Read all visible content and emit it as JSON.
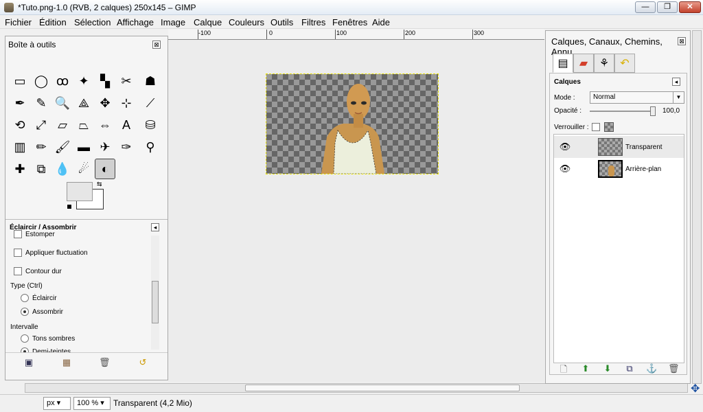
{
  "window": {
    "title": "*Tuto.png-1.0 (RVB, 2 calques) 250x145 – GIMP",
    "minimize": "—",
    "maximize": "❐",
    "close": "✕"
  },
  "menu": [
    "Fichier",
    "Édition",
    "Sélection",
    "Affichage",
    "Image",
    "Calque",
    "Couleurs",
    "Outils",
    "Filtres",
    "Fenêtres",
    "Aide"
  ],
  "ruler": {
    "labels": [
      "-100",
      "0",
      "100",
      "200",
      "300"
    ]
  },
  "toolbox": {
    "title": "Boîte à outils",
    "close": "⊠",
    "tools": [
      [
        "rect-select-icon",
        "▭"
      ],
      [
        "ellipse-select-icon",
        "◯"
      ],
      [
        "free-select-icon",
        "ꝏ"
      ],
      [
        "fuzzy-select-icon",
        "✦"
      ],
      [
        "color-select-icon",
        "▚"
      ],
      [
        "scissors-icon",
        "✂"
      ],
      [
        "foreground-select-icon",
        "☗"
      ],
      [
        "paths-icon",
        "✒"
      ],
      [
        "color-picker-icon",
        "✎"
      ],
      [
        "zoom-icon",
        "🔍"
      ],
      [
        "measure-icon",
        "⟁"
      ],
      [
        "move-icon",
        "✥"
      ],
      [
        "align-icon",
        "⊹"
      ],
      [
        "crop-icon",
        "⟋"
      ],
      [
        "rotate-icon",
        "⟲"
      ],
      [
        "scale-icon",
        "⤢"
      ],
      [
        "shear-icon",
        "▱"
      ],
      [
        "perspective-icon",
        "⏢"
      ],
      [
        "flip-icon",
        "⇔"
      ],
      [
        "text-icon",
        "A"
      ],
      [
        "bucket-fill-icon",
        "⛁"
      ],
      [
        "blend-icon",
        "▥"
      ],
      [
        "pencil-icon",
        "✏"
      ],
      [
        "paintbrush-icon",
        "🖌"
      ],
      [
        "eraser-icon",
        "▬"
      ],
      [
        "airbrush-icon",
        "✈"
      ],
      [
        "ink-icon",
        "✑"
      ],
      [
        "clone-icon",
        "⚲"
      ],
      [
        "heal-icon",
        "✚"
      ],
      [
        "perspective-clone-icon",
        "⧉"
      ],
      [
        "blur-icon",
        "💧"
      ],
      [
        "smudge-icon",
        "☄"
      ],
      [
        "dodge-burn-icon",
        "◐"
      ]
    ],
    "options": {
      "title": "Éclaircir / Assombrir",
      "menu": "◂",
      "estomper": "Estomper",
      "fluctuation": "Appliquer fluctuation",
      "contour": "Contour dur",
      "type_label": "Type  (Ctrl)",
      "eclaircir": "Éclaircir",
      "assombrir": "Assombrir",
      "intervalle": "Intervalle",
      "tons_sombres": "Tons sombres",
      "demi_teintes": "Demi-teintes"
    }
  },
  "layers": {
    "title": "Calques, Canaux, Chemins, Annu...",
    "close": "⊠",
    "section": "Calques",
    "menu": "◂",
    "mode_label": "Mode :",
    "mode_value": "Normal",
    "opacity_label": "Opacité :",
    "opacity_value": "100,0",
    "opacity_fraction": 1.0,
    "lock_label": "Verrouiller :",
    "items": [
      {
        "name": "Transparent"
      },
      {
        "name": "Arrière-plan"
      }
    ],
    "eye": "👁"
  },
  "status": {
    "unit": "px",
    "zoom": "100 %",
    "info": "Transparent (4,2 Mio)"
  },
  "colors": {
    "accent": "#d33e2a",
    "checker_dark": "#666666",
    "checker_light": "#999999",
    "selection": "#e8e000"
  }
}
